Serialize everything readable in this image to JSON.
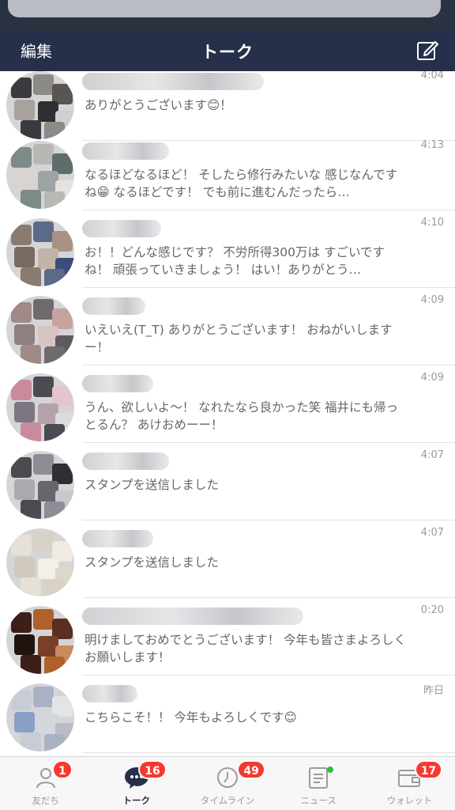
{
  "header": {
    "edit_label": "編集",
    "title": "トーク",
    "compose_icon": "compose-icon"
  },
  "chats": [
    {
      "time": "4:04",
      "message": "ありがとうございます😊！",
      "avatar_colors": [
        "#3a3a40",
        "#8c8a86",
        "#5a5550",
        "#a7a39c",
        "#2e2e33",
        "#cfcfd2"
      ]
    },
    {
      "time": "4:13",
      "message": "なるほどなるほど！ そしたら修行みたいな 感じなんですね😁 なるほどです！ でも前に進むんだったら…",
      "avatar_colors": [
        "#7c8a88",
        "#b9b7b4",
        "#5d6d6c",
        "#d8d4cf",
        "#9ea4a3",
        "#e5e1dc"
      ]
    },
    {
      "time": "4:10",
      "message": "お！！どんな感じです？ 不労所得300万は すごいですね！ 頑張っていきましょう！ はい！ありがとう…",
      "avatar_colors": [
        "#8a7b70",
        "#5c6a8a",
        "#a99283",
        "#7b6a60",
        "#c2b4a8",
        "#3d4c78"
      ]
    },
    {
      "time": "4:09",
      "message": "いえいえ(T_T) ありがとうございます！ おねがいしますー！",
      "avatar_colors": [
        "#a08a88",
        "#6f6a6d",
        "#c7a3a0",
        "#8f7f80",
        "#d8c4c2",
        "#5e5a5e"
      ]
    },
    {
      "time": "4:09",
      "message": "うん、欲しいよ〜！ なれたなら良かった笑 福井にも帰っとるん？ あけおめーー！",
      "avatar_colors": [
        "#c98a9c",
        "#4c4a52",
        "#e3c5cf",
        "#7b7680",
        "#b4a2aa",
        "#dedbe0"
      ]
    },
    {
      "time": "4:07",
      "message": "スタンプを送信しました",
      "avatar_colors": [
        "#4b4b52",
        "#8d8d95",
        "#2f2f35",
        "#a9a9b0",
        "#66666e",
        "#c8c8cd"
      ]
    },
    {
      "time": "4:07",
      "message": "スタンプを送信しました",
      "avatar_colors": [
        "#e6e0d6",
        "#d7d1c6",
        "#efeae2",
        "#cfc8bc",
        "#f3efe9",
        "#ddd6cb"
      ]
    },
    {
      "time": "0:20",
      "message": "明けましておめでとうございます！ 今年も皆さまよろしくお願いします！",
      "avatar_colors": [
        "#3b1f18",
        "#b0602a",
        "#5a2e22",
        "#20140f",
        "#7a3f2a",
        "#c98b5a"
      ]
    },
    {
      "time": "昨日",
      "message": "こちらこそ！！ 今年もよろしくです😊",
      "avatar_colors": [
        "#c8ccd4",
        "#a9b2c5",
        "#e2e4e8",
        "#8aa0c8",
        "#d3d6dc",
        "#b8bcc4"
      ]
    }
  ],
  "tabs": [
    {
      "label": "友だち",
      "badge": "1",
      "icon": "person-icon"
    },
    {
      "label": "トーク",
      "badge": "16",
      "icon": "chat-bubble-icon"
    },
    {
      "label": "タイムライン",
      "badge": "49",
      "icon": "clock-icon"
    },
    {
      "label": "ニュース",
      "badge": "",
      "icon": "news-icon"
    },
    {
      "label": "ウォレット",
      "badge": "17",
      "icon": "wallet-icon"
    }
  ],
  "colors": {
    "nav_bg": "#27304a",
    "badge_red": "#f43a2f",
    "news_dot": "#22c23a"
  }
}
